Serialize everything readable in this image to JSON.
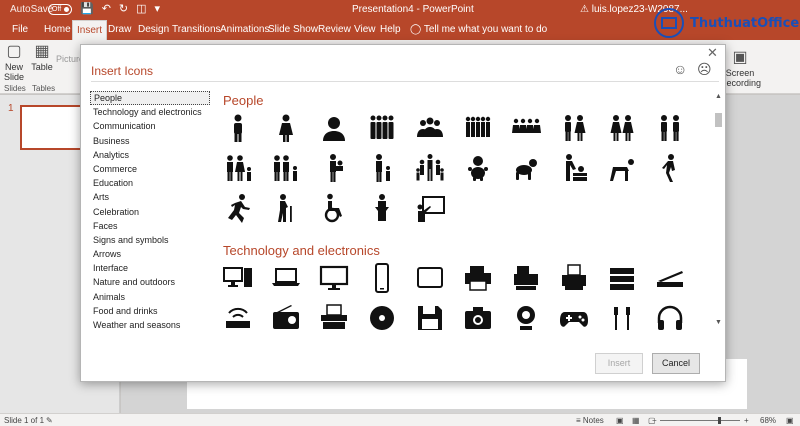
{
  "titlebar": {
    "autosave": "AutoSave",
    "autosave_state": "Off",
    "doc_title": "Presentation4 - PowerPoint",
    "user": "luis.lopez23-W2087..."
  },
  "ribbon_tabs": [
    {
      "label": "File",
      "active": false
    },
    {
      "label": "Home",
      "active": false
    },
    {
      "label": "Insert",
      "active": true
    },
    {
      "label": "Draw",
      "active": false
    },
    {
      "label": "Design",
      "active": false
    },
    {
      "label": "Transitions",
      "active": false
    },
    {
      "label": "Animations",
      "active": false
    },
    {
      "label": "Slide Show",
      "active": false
    },
    {
      "label": "Review",
      "active": false
    },
    {
      "label": "View",
      "active": false
    },
    {
      "label": "Help",
      "active": false
    }
  ],
  "tell_me": "Tell me what you want to do",
  "ribbon": {
    "new_slide": "New Slide",
    "table": "Table",
    "pictures": "Picture",
    "slides_group": "Slides",
    "tables_group": "Tables",
    "screen_recording": "Screen Recording"
  },
  "thumbnails": {
    "slide_number": "1"
  },
  "dialog": {
    "title": "Insert Icons",
    "categories": [
      "People",
      "Technology and electronics",
      "Communication",
      "Business",
      "Analytics",
      "Commerce",
      "Education",
      "Arts",
      "Celebration",
      "Faces",
      "Signs and symbols",
      "Arrows",
      "Interface",
      "Nature and outdoors",
      "Animals",
      "Food and drinks",
      "Weather and seasons"
    ],
    "selected_category": "People",
    "sections": [
      {
        "title": "People",
        "icons": [
          "man-icon",
          "woman-icon",
          "user-icon",
          "group-four-icon",
          "group-meeting-icon",
          "group-six-icon",
          "group-line-icon",
          "man-woman-icon",
          "women-pair-icon",
          "men-pair-icon",
          "family-icon",
          "family-two-icon",
          "parent-baby-icon",
          "parent-child-icon",
          "big-family-icon",
          "baby-icon",
          "crawling-baby-icon",
          "diaper-change-icon",
          "crawling-man-icon",
          "walking-icon",
          "running-icon",
          "elderly-icon",
          "wheelchair-icon",
          "speaker-podium-icon",
          "presenter-board-icon"
        ]
      },
      {
        "title": "Technology and electronics",
        "icons": [
          "desktop-computer-icon",
          "laptop-icon",
          "monitor-icon",
          "smartphone-icon",
          "tablet-icon",
          "printer-icon",
          "fax-icon",
          "receipt-printer-icon",
          "server-icon",
          "scanner-icon",
          "router-icon",
          "radio-icon",
          "typewriter-icon",
          "disc-icon",
          "floppy-disk-icon",
          "camera-icon",
          "webcam-icon",
          "gamepad-icon",
          "earbuds-icon",
          "headphones-icon"
        ]
      }
    ],
    "insert_button": "Insert",
    "cancel_button": "Cancel"
  },
  "statusbar": {
    "slide_info": "Slide 1 of 1",
    "notes": "Notes",
    "zoom": "68%"
  },
  "watermark": {
    "text": "ThuthuatOffice"
  },
  "colors": {
    "accent": "#b7472a",
    "icon": "#111111"
  }
}
